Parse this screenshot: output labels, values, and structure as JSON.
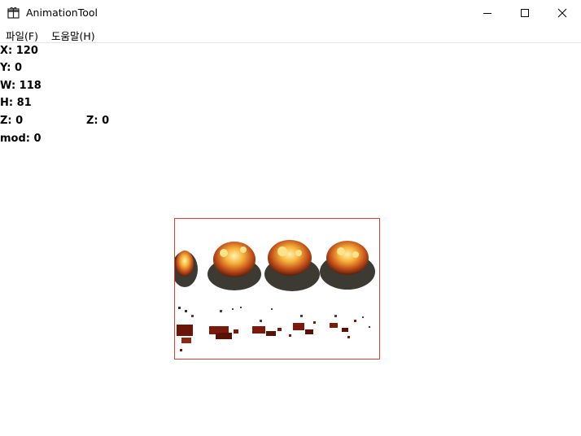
{
  "window": {
    "title": "AnimationTool",
    "icon": "gift-icon",
    "controls": [
      "minimize-icon",
      "maximize-icon",
      "close-icon"
    ]
  },
  "menu": {
    "items": [
      {
        "label": "파일(F)"
      },
      {
        "label": "도움말(H)"
      }
    ]
  },
  "info": {
    "x": "X: 120",
    "y": "Y: 0",
    "w": "W: 118",
    "h": "H: 81",
    "z1": "Z: 0",
    "z2": "Z: 0",
    "mod": "mod: 0"
  },
  "canvas": {
    "border_color": "#e53935",
    "content": "explosion-sprite-sheet"
  }
}
